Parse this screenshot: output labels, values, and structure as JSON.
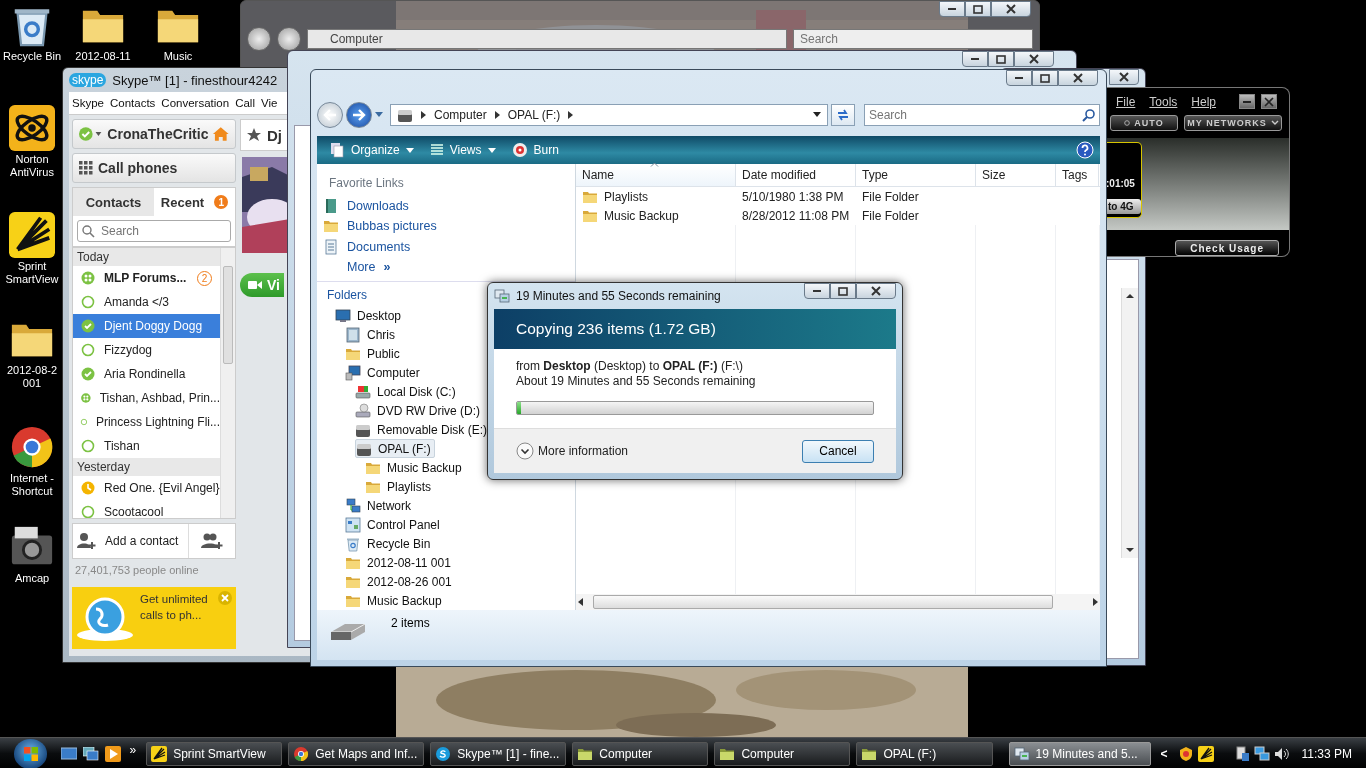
{
  "desktop_icons": [
    {
      "label": "Recycle Bin",
      "kind": "recycle"
    },
    {
      "label": "2012-08-11",
      "kind": "folder"
    },
    {
      "label": "Music",
      "kind": "folder"
    },
    {
      "label": "Norton AntiVirus",
      "kind": "norton"
    },
    {
      "label": "Sprint SmartView",
      "kind": "sprint"
    },
    {
      "label": "2012-08-2 001",
      "kind": "folder"
    },
    {
      "label": "Internet - Shortcut",
      "kind": "chrome"
    },
    {
      "label": "Amcap",
      "kind": "camera"
    }
  ],
  "back_window": {
    "address": "Computer",
    "search_placeholder": "Search"
  },
  "skype": {
    "title": "Skype™ [1] - finesthour4242",
    "menu": [
      "Skype",
      "Contacts",
      "Conversation",
      "Call",
      "Vie"
    ],
    "user": "CronaTheCritic",
    "call_phones": "Call phones",
    "tabs": [
      {
        "label": "Contacts",
        "selected": false
      },
      {
        "label": "Recent",
        "selected": true,
        "badge": "1"
      }
    ],
    "search_placeholder": "Search",
    "groups": [
      {
        "heading": "Today",
        "contacts": [
          {
            "name": "MLP Forums...",
            "kind": "group",
            "unread": true,
            "badge": "2",
            "selected": false
          },
          {
            "name": "Amanda </3",
            "kind": "offline",
            "unread": false,
            "selected": false
          },
          {
            "name": "Djent Doggy Dogg",
            "kind": "online",
            "unread": false,
            "selected": true
          },
          {
            "name": "Fizzydog",
            "kind": "offline",
            "unread": false,
            "selected": false
          },
          {
            "name": "Aria Rondinella",
            "kind": "online",
            "unread": false,
            "selected": false
          },
          {
            "name": "Tishan, Ashbad, Prin...",
            "kind": "group",
            "unread": false,
            "selected": false
          },
          {
            "name": "Princess Lightning Fli...",
            "kind": "offline",
            "unread": false,
            "selected": false
          },
          {
            "name": "Tishan",
            "kind": "offline",
            "unread": false,
            "selected": false
          }
        ]
      },
      {
        "heading": "Yesterday",
        "contacts": [
          {
            "name": "Red One. {Evil Angel}",
            "kind": "away",
            "unread": false,
            "selected": false
          },
          {
            "name": "Scootacool",
            "kind": "offline",
            "unread": false,
            "selected": false
          }
        ]
      }
    ],
    "add_contact": "Add a contact",
    "online_count": "27,401,753 people online",
    "ad": "Get unlimited calls to ph...",
    "conversation_title": "Dj",
    "video_button": "Vi"
  },
  "explorer": {
    "address": [
      "Computer",
      "OPAL (F:)"
    ],
    "search_placeholder": "Search",
    "toolbar": [
      "Organize",
      "Views",
      "Burn"
    ],
    "favorite_links_heading": "Favorite Links",
    "favorite_links": [
      {
        "label": "Downloads",
        "kind": "downloads"
      },
      {
        "label": "Bubbas pictures",
        "kind": "folder"
      },
      {
        "label": "Documents",
        "kind": "documents"
      }
    ],
    "more_link": "More",
    "more_glyph": "»",
    "folders_heading": "Folders",
    "tree": [
      {
        "label": "Desktop",
        "kind": "desktop",
        "selected": false,
        "children": [
          {
            "label": "Chris",
            "kind": "user",
            "selected": false
          },
          {
            "label": "Public",
            "kind": "folder",
            "selected": false
          },
          {
            "label": "Computer",
            "kind": "computer",
            "selected": false,
            "children": [
              {
                "label": "Local Disk (C:)",
                "kind": "disk",
                "selected": false
              },
              {
                "label": "DVD RW Drive (D:)",
                "kind": "dvd",
                "selected": false
              },
              {
                "label": "Removable Disk (E:)",
                "kind": "drive",
                "selected": false
              },
              {
                "label": "OPAL (F:)",
                "kind": "drive",
                "selected": true,
                "children": [
                  {
                    "label": "Music Backup",
                    "kind": "folder",
                    "selected": false
                  },
                  {
                    "label": "Playlists",
                    "kind": "folder",
                    "selected": false
                  }
                ]
              }
            ]
          },
          {
            "label": "Network",
            "kind": "network",
            "selected": false
          },
          {
            "label": "Control Panel",
            "kind": "panel",
            "selected": false
          },
          {
            "label": "Recycle Bin",
            "kind": "recycle",
            "selected": false
          },
          {
            "label": "2012-08-11 001",
            "kind": "folder",
            "selected": false
          },
          {
            "label": "2012-08-26 001",
            "kind": "folder",
            "selected": false
          },
          {
            "label": "Music Backup",
            "kind": "folder",
            "selected": false
          }
        ]
      }
    ],
    "columns": [
      {
        "label": "Name",
        "sorted": true
      },
      {
        "label": "Date modified",
        "sorted": false
      },
      {
        "label": "Type",
        "sorted": false
      },
      {
        "label": "Size",
        "sorted": false
      },
      {
        "label": "Tags",
        "sorted": false
      }
    ],
    "rows": [
      {
        "name": "Playlists",
        "date": "5/10/1980 1:38 PM",
        "type": "File Folder"
      },
      {
        "name": "Music Backup",
        "date": "8/28/2012 11:08 PM",
        "type": "File Folder"
      }
    ],
    "status": "2 items"
  },
  "copy_dialog": {
    "title": "19 Minutes and 55 Seconds remaining",
    "heading": "Copying 236 items (1.72 GB)",
    "from_line": "from **Desktop** (Desktop) to **OPAL (F:)** (F:\\)",
    "remaining": "About 19 Minutes and 55 Seconds remaining",
    "level": 0.005,
    "more_info": "More information",
    "expanded": false,
    "cancel": "Cancel"
  },
  "sprint_panel": {
    "menu": [
      "File",
      "Tools",
      "Help"
    ],
    "mode_button": "AUTO",
    "networks_button": "MY NETWORKS",
    "timer": ":01:05",
    "upgrade_button": "to 4G",
    "usage_button": "Check Usage"
  },
  "taskbar": {
    "quick_launch_more": "»",
    "buttons": [
      {
        "label": "Sprint SmartView",
        "kind": "sprint",
        "selected": false
      },
      {
        "label": "Get Maps and Inf...",
        "kind": "chrome",
        "selected": false
      },
      {
        "label": "Skype™ [1] - fine...",
        "kind": "skype",
        "selected": false
      },
      {
        "label": "Computer",
        "kind": "explorer",
        "selected": false
      },
      {
        "label": "Computer",
        "kind": "explorer",
        "selected": false
      },
      {
        "label": "OPAL (F:)",
        "kind": "explorer",
        "selected": false
      },
      {
        "label": "19 Minutes and 5...",
        "kind": "copy",
        "selected": true
      }
    ],
    "tray_expand": "<",
    "clock": "11:33 PM"
  }
}
